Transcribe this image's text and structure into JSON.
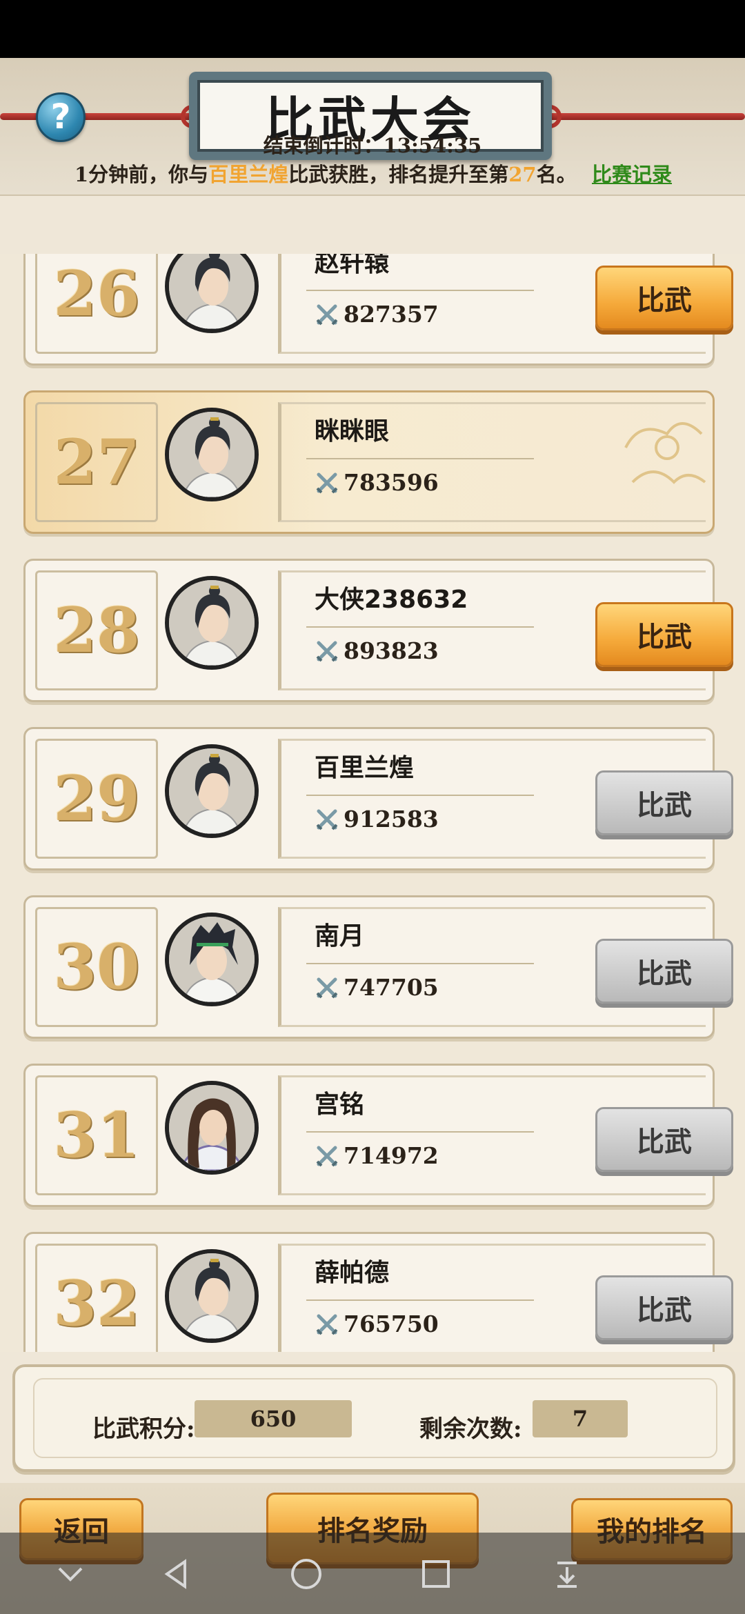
{
  "header": {
    "help_label": "?",
    "title": "比武大会"
  },
  "status": {
    "countdown": "结束倒计时：13:54:35",
    "news_prefix": "1分钟前，你与",
    "news_opponent": "百里兰煌",
    "news_mid": "比武获胜，排名提升至第",
    "news_rank": "27",
    "news_suffix": "名。",
    "record_link": "比赛记录"
  },
  "fight_label": "比武",
  "players": [
    {
      "rank": "26",
      "name": "赵轩辕",
      "power": "827357",
      "button": "active"
    },
    {
      "rank": "27",
      "name": "眯眯眼",
      "power": "783596",
      "button": "none"
    },
    {
      "rank": "28",
      "name": "大侠238632",
      "power": "893823",
      "button": "active"
    },
    {
      "rank": "29",
      "name": "百里兰煌",
      "power": "912583",
      "button": "disabled"
    },
    {
      "rank": "30",
      "name": "南月",
      "power": "747705",
      "button": "disabled"
    },
    {
      "rank": "31",
      "name": "宫铭",
      "power": "714972",
      "button": "disabled"
    },
    {
      "rank": "32",
      "name": "薛帕德",
      "power": "765750",
      "button": "disabled"
    }
  ],
  "score": {
    "points_label": "比武积分:",
    "points_value": "650",
    "remaining_label": "剩余次数:",
    "remaining_value": "7"
  },
  "bottom": {
    "back_label": "返回",
    "reward_label": "排名奖励",
    "my_rank_label": "我的排名"
  },
  "colors": {
    "highlight": "#f1a431",
    "link": "#2f8a1a",
    "button_active": "#f5a93a",
    "button_disabled": "#b9b9b9"
  }
}
